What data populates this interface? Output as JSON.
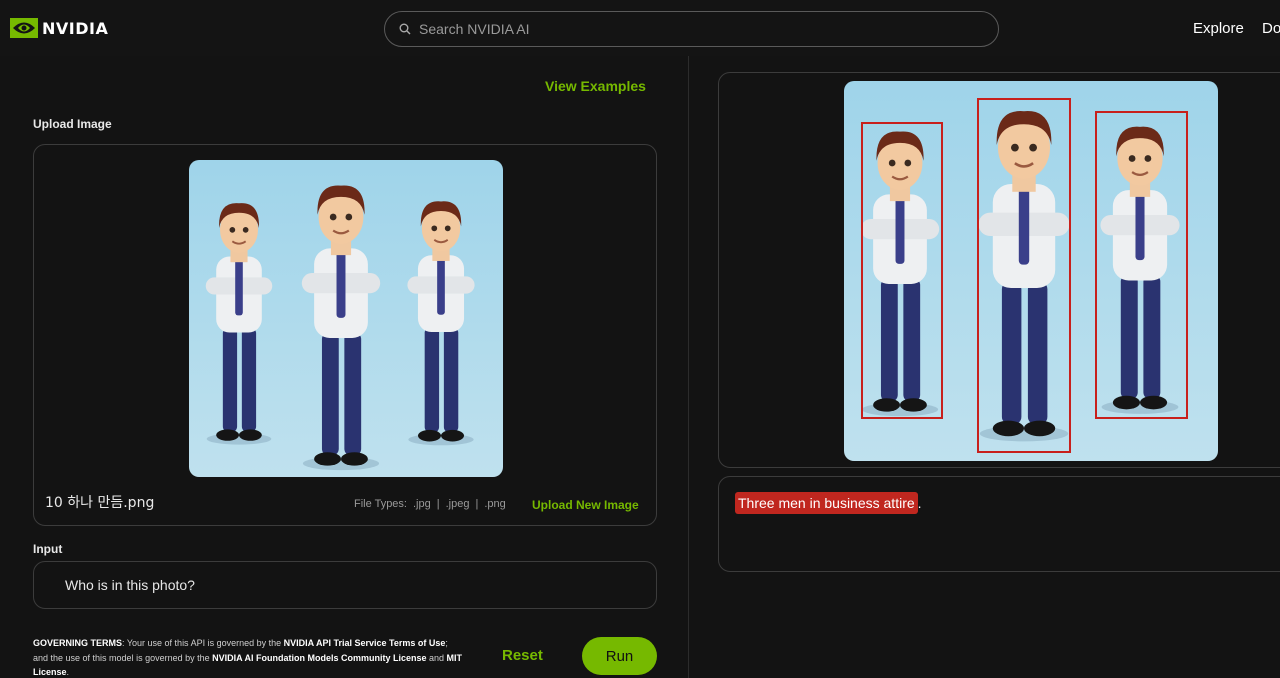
{
  "header": {
    "brand": "NVIDIA",
    "search_placeholder": "Search NVIDIA AI",
    "nav": [
      "Explore",
      "Do"
    ]
  },
  "left": {
    "view_examples": "View Examples",
    "upload_label": "Upload Image",
    "filename": "10 하나 만듬.png",
    "file_types_label": "File Types:",
    "file_types": [
      ".jpg",
      ".jpeg",
      ".png"
    ],
    "upload_new": "Upload New Image",
    "input_label": "Input",
    "input_value": "Who is in this photo?",
    "terms": {
      "prefix": "GOVERNING TERMS",
      "t1": ": Your use of this API is governed by the ",
      "link1": "NVIDIA API Trial Service Terms of Use",
      "t2": "; and the use of this model is governed by the ",
      "link2": "NVIDIA AI Foundation Models Community License",
      "t3": " and ",
      "link3": "MIT License",
      "t4": "."
    },
    "reset_label": "Reset",
    "run_label": "Run"
  },
  "right": {
    "answer_highlight": "Three men in business attire",
    "answer_suffix": "."
  },
  "colors": {
    "accent": "#76b900",
    "highlight": "#c0271f",
    "bbox": "#c8201c"
  }
}
